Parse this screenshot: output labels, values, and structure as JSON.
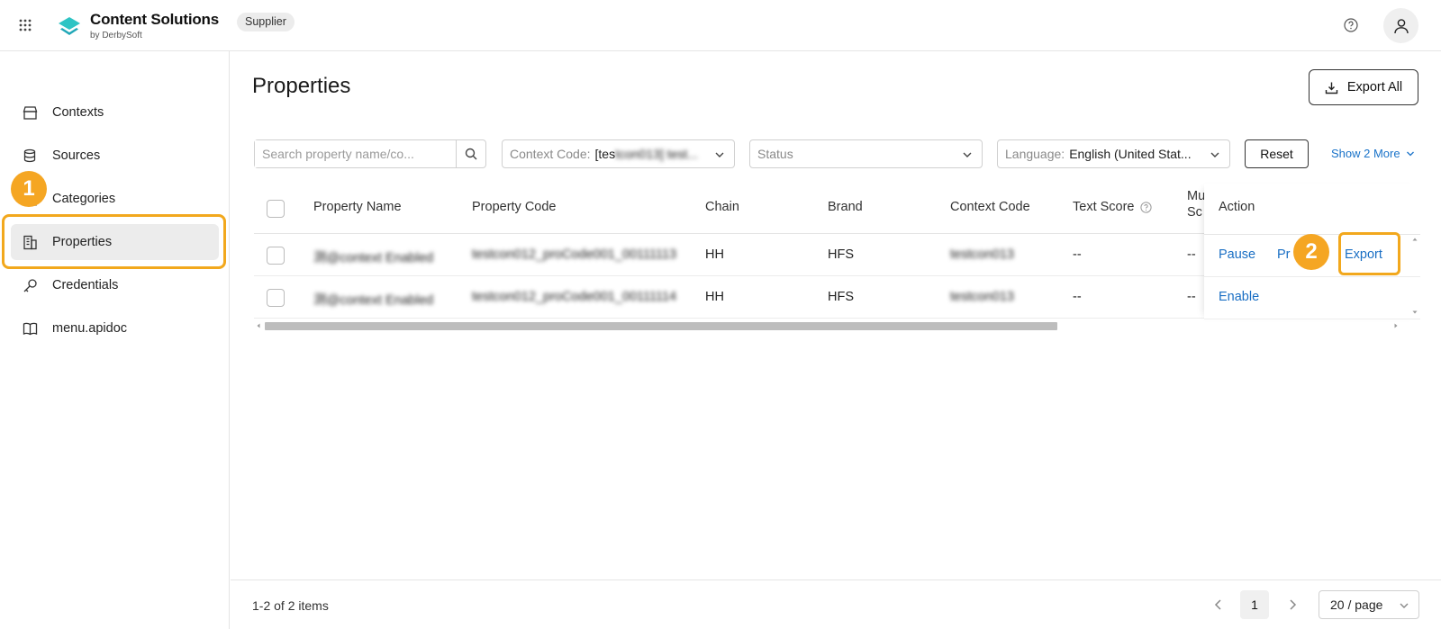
{
  "header": {
    "title": "Content Solutions",
    "subtitle": "by DerbySoft",
    "badge": "Supplier",
    "brand_color": "#2ec4c4"
  },
  "sidebar": {
    "items": [
      {
        "label": "Contexts",
        "icon": "store-icon"
      },
      {
        "label": "Sources",
        "icon": "database-icon"
      },
      {
        "label": "Categories",
        "icon": "category-icon"
      },
      {
        "label": "Properties",
        "icon": "building-icon",
        "active": true
      },
      {
        "label": "Credentials",
        "icon": "key-icon"
      },
      {
        "label": "menu.apidoc",
        "icon": "book-icon"
      }
    ]
  },
  "main": {
    "title": "Properties",
    "export_all_label": "Export All"
  },
  "filters": {
    "search_placeholder": "Search property name/co...",
    "context_label": "Context Code:",
    "context_value_visible": "[tes",
    "context_value_blurred": "tcon013] test...",
    "status_placeholder": "Status",
    "language_label": "Language:",
    "language_value": "English (United Stat...",
    "reset_label": "Reset",
    "show_more_label": "Show 2 More"
  },
  "table": {
    "columns": [
      "Property Name",
      "Property Code",
      "Chain",
      "Brand",
      "Context Code",
      "Text Score",
      "Mu Sc",
      "Action"
    ],
    "rows": [
      {
        "property_name": "测@context Enabled",
        "property_code": "testcon012_proCode001_00111113",
        "chain": "HH",
        "brand": "HFS",
        "context_code": "testcon013",
        "text_score": "--",
        "mu_score": "--",
        "actions": [
          "Pause",
          "Pr",
          "Export"
        ]
      },
      {
        "property_name": "测@context Enabled",
        "property_code": "testcon012_proCode001_00111114",
        "chain": "HH",
        "brand": "HFS",
        "context_code": "testcon013",
        "text_score": "--",
        "mu_score": "--",
        "actions": [
          "Enable"
        ]
      }
    ]
  },
  "pagination": {
    "summary": "1-2 of 2 items",
    "current_page": "1",
    "page_size": "20 / page"
  },
  "annotations": {
    "step1": "1",
    "step2": "2",
    "highlight_color": "#f5a623"
  },
  "colors": {
    "link": "#1a6fc4",
    "active_nav_bg": "#ececec"
  }
}
